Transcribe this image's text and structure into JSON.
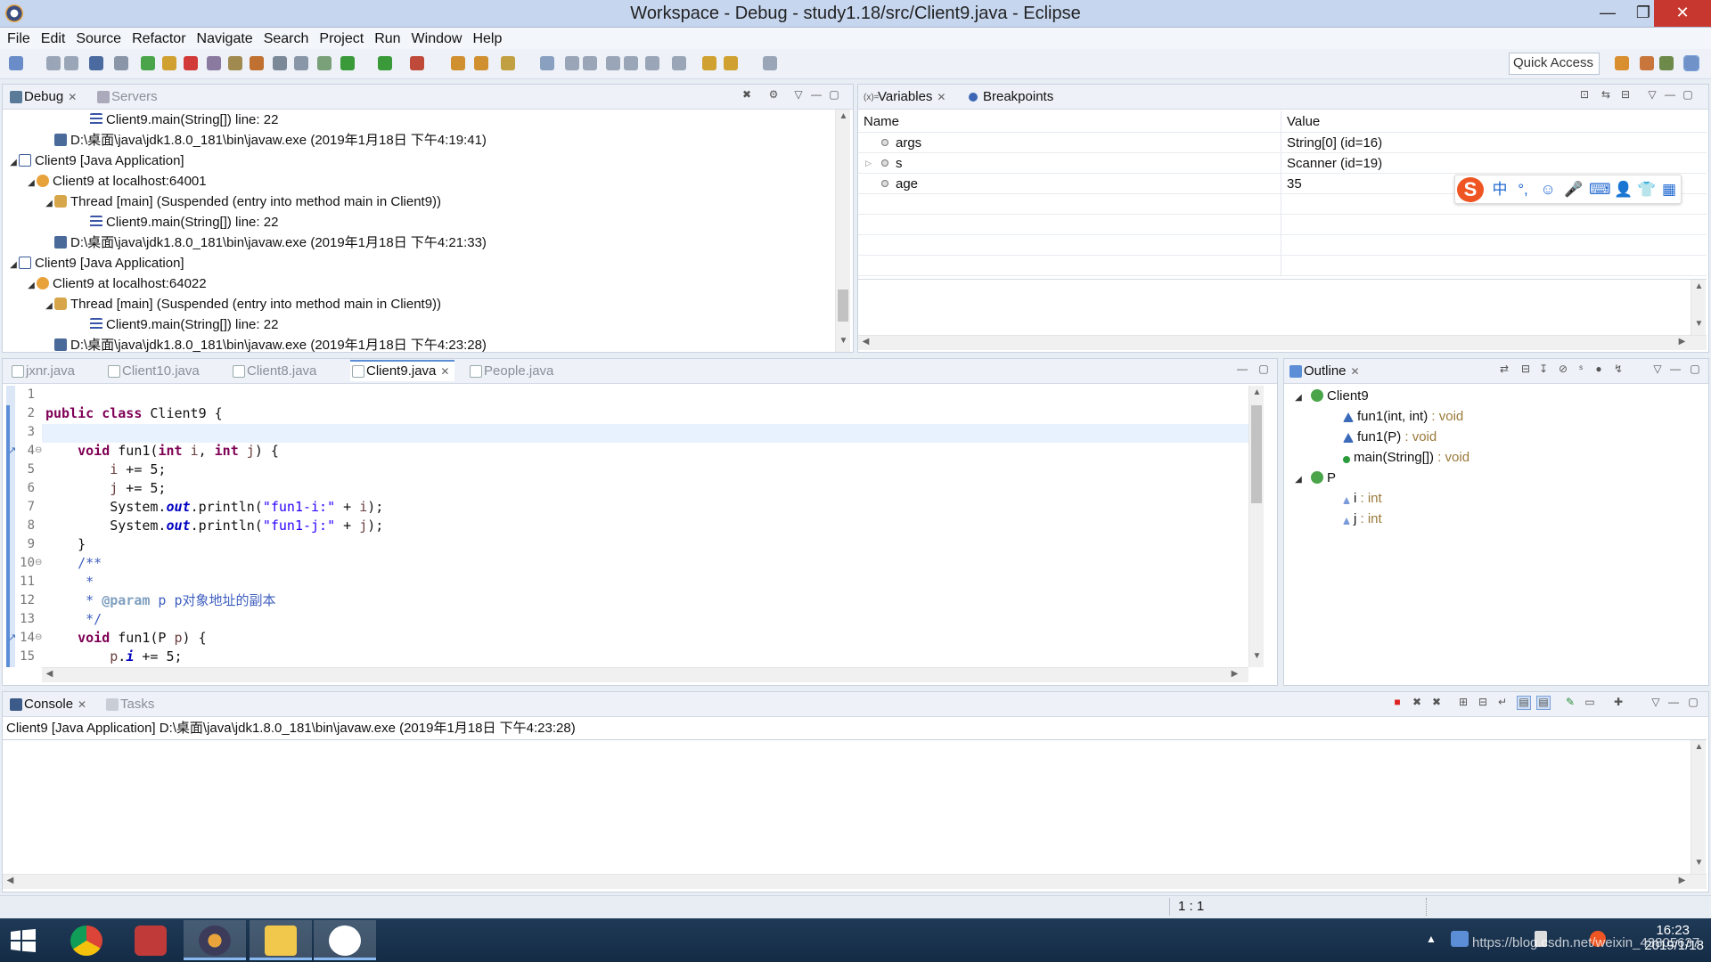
{
  "window": {
    "title": "Workspace - Debug - study1.18/src/Client9.java - Eclipse",
    "minimize": "—",
    "maximize": "❐",
    "close": "✕"
  },
  "menu": [
    "File",
    "Edit",
    "Source",
    "Refactor",
    "Navigate",
    "Search",
    "Project",
    "Run",
    "Window",
    "Help"
  ],
  "toolbar": {
    "quick_access": "Quick Access"
  },
  "debug_panel": {
    "tabs": [
      {
        "label": "Debug",
        "active": true
      },
      {
        "label": "Servers",
        "active": false
      }
    ],
    "tree": [
      {
        "indent": 4,
        "icon": "stack",
        "text": "Client9.main(String[]) line: 22"
      },
      {
        "indent": 2,
        "icon": "proc",
        "text": "D:\\桌面\\java\\jdk1.8.0_181\\bin\\javaw.exe (2019年1月18日 下午4:19:41)"
      },
      {
        "indent": 0,
        "icon": "app",
        "text": "Client9 [Java Application]",
        "expanded": true
      },
      {
        "indent": 1,
        "icon": "vm",
        "text": "Client9 at localhost:64001",
        "expanded": true
      },
      {
        "indent": 2,
        "icon": "thread",
        "text": "Thread [main] (Suspended (entry into method main in Client9))",
        "expanded": true
      },
      {
        "indent": 4,
        "icon": "stack",
        "text": "Client9.main(String[]) line: 22"
      },
      {
        "indent": 2,
        "icon": "proc",
        "text": "D:\\桌面\\java\\jdk1.8.0_181\\bin\\javaw.exe (2019年1月18日 下午4:21:33)"
      },
      {
        "indent": 0,
        "icon": "app",
        "text": "Client9 [Java Application]",
        "expanded": true
      },
      {
        "indent": 1,
        "icon": "vm",
        "text": "Client9 at localhost:64022",
        "expanded": true
      },
      {
        "indent": 2,
        "icon": "thread",
        "text": "Thread [main] (Suspended (entry into method main in Client9))",
        "expanded": true
      },
      {
        "indent": 4,
        "icon": "stack",
        "text": "Client9.main(String[]) line: 22"
      },
      {
        "indent": 2,
        "icon": "proc",
        "text": "D:\\桌面\\java\\jdk1.8.0_181\\bin\\javaw.exe (2019年1月18日 下午4:23:28)"
      }
    ]
  },
  "variables_panel": {
    "tabs": [
      {
        "label": "Variables",
        "active": true
      },
      {
        "label": "Breakpoints",
        "active": false
      }
    ],
    "columns": [
      "Name",
      "Value"
    ],
    "rows": [
      {
        "name": "args",
        "value": "String[0]  (id=16)",
        "expandable": false
      },
      {
        "name": "s",
        "value": "Scanner  (id=19)",
        "expandable": true
      },
      {
        "name": "age",
        "value": "35",
        "expandable": false
      }
    ]
  },
  "ime_toolbar": {
    "logo": "S",
    "items": [
      "中",
      "°,",
      "☺",
      "🎤",
      "⌨",
      "👤",
      "👕",
      "▦"
    ]
  },
  "editor": {
    "tabs": [
      {
        "label": "jxnr.java",
        "active": false
      },
      {
        "label": "Client10.java",
        "active": false
      },
      {
        "label": "Client8.java",
        "active": false
      },
      {
        "label": "Client9.java",
        "active": true
      },
      {
        "label": "People.java",
        "active": false
      }
    ],
    "lines": [
      {
        "n": "1",
        "html": ""
      },
      {
        "n": "2",
        "html": "<span class=\"kw\">public class</span> Client9 {"
      },
      {
        "n": "3",
        "html": ""
      },
      {
        "n": "4",
        "html": "    <span class=\"kw\">void</span> fun1(<span class=\"kw\">int</span> <span class=\"var\">i</span>, <span class=\"kw\">int</span> <span class=\"var\">j</span>) {"
      },
      {
        "n": "5",
        "html": "        <span class=\"var\">i</span> += 5;"
      },
      {
        "n": "6",
        "html": "        <span class=\"var\">j</span> += 5;"
      },
      {
        "n": "7",
        "html": "        System.<span class=\"fld\">out</span>.println(<span class=\"str\">\"fun1-i:\"</span> + <span class=\"var\">i</span>);"
      },
      {
        "n": "8",
        "html": "        System.<span class=\"fld\">out</span>.println(<span class=\"str\">\"fun1-j:\"</span> + <span class=\"var\">j</span>);"
      },
      {
        "n": "9",
        "html": "    }"
      },
      {
        "n": "10",
        "html": "    <span class=\"cmt\">/**</span>"
      },
      {
        "n": "11",
        "html": "     <span class=\"cmt\">*</span>"
      },
      {
        "n": "12",
        "html": "     <span class=\"cmt\">* </span><span class=\"tag\">@param</span><span class=\"cmt\"> p p对象地址的副本</span>"
      },
      {
        "n": "13",
        "html": "     <span class=\"cmt\">*/</span>"
      },
      {
        "n": "14",
        "html": "    <span class=\"kw\">void</span> fun1(P <span class=\"var\">p</span>) {"
      },
      {
        "n": "15",
        "html": "        <span class=\"var\">p</span>.<span class=\"fld\">i</span> += 5;"
      }
    ]
  },
  "outline": {
    "tab": "Outline",
    "items": [
      {
        "level": 0,
        "icon": "class",
        "text": "Client9",
        "type": ""
      },
      {
        "level": 1,
        "icon": "method-default",
        "text": "fun1(int, int)",
        "type": " : void"
      },
      {
        "level": 1,
        "icon": "method-default",
        "text": "fun1(P)",
        "type": " : void"
      },
      {
        "level": 1,
        "icon": "method-public-static",
        "text": "main(String[])",
        "type": " : void"
      },
      {
        "level": 0,
        "icon": "class",
        "text": "P",
        "type": ""
      },
      {
        "level": 1,
        "icon": "field-default",
        "text": "i",
        "type": " : int"
      },
      {
        "level": 1,
        "icon": "field-default",
        "text": "j",
        "type": " : int"
      }
    ]
  },
  "console": {
    "tabs": [
      {
        "label": "Console",
        "active": true
      },
      {
        "label": "Tasks",
        "active": false
      }
    ],
    "header": "Client9 [Java Application] D:\\桌面\\java\\jdk1.8.0_181\\bin\\javaw.exe (2019年1月18日 下午4:23:28)"
  },
  "statusbar": {
    "position": "1 : 1"
  },
  "taskbar": {
    "time": "16:23",
    "date": "2019/1/18",
    "watermark": "https://blog.csdn.net/weixin_43805637"
  },
  "colors": {
    "titlebar": "#c6d6ee",
    "keyword": "#7f0055",
    "string": "#2a00ff",
    "comment": "#3f5fbf",
    "close_button": "#c7372f"
  }
}
